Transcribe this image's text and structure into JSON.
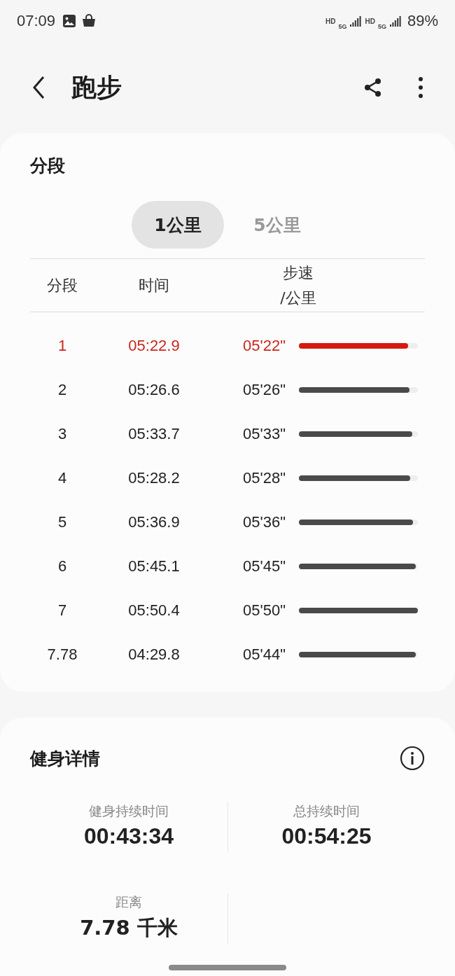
{
  "status_bar": {
    "time": "07:09",
    "battery": "89%",
    "network_labels": [
      "HD",
      "5G",
      "HD",
      "5G"
    ]
  },
  "header": {
    "title": "跑步"
  },
  "splits": {
    "title": "分段",
    "tabs": [
      {
        "label": "1公里",
        "selected": true
      },
      {
        "label": "5公里",
        "selected": false
      }
    ],
    "columns": [
      "分段",
      "时间",
      "步速\n/公里"
    ],
    "rows": [
      {
        "segment": "1",
        "time": "05:22.9",
        "pace": "05'22\"",
        "level": 0.92,
        "highlighted": true
      },
      {
        "segment": "2",
        "time": "05:26.6",
        "pace": "05'26\"",
        "level": 0.93,
        "highlighted": false
      },
      {
        "segment": "3",
        "time": "05:33.7",
        "pace": "05'33\"",
        "level": 0.95,
        "highlighted": false
      },
      {
        "segment": "4",
        "time": "05:28.2",
        "pace": "05'28\"",
        "level": 0.935,
        "highlighted": false
      },
      {
        "segment": "5",
        "time": "05:36.9",
        "pace": "05'36\"",
        "level": 0.96,
        "highlighted": false
      },
      {
        "segment": "6",
        "time": "05:45.1",
        "pace": "05'45\"",
        "level": 0.98,
        "highlighted": false
      },
      {
        "segment": "7",
        "time": "05:50.4",
        "pace": "05'50\"",
        "level": 1,
        "highlighted": false
      },
      {
        "segment": "7.78",
        "time": "04:29.8",
        "pace": "05'44\"",
        "level": 0.98,
        "highlighted": false
      }
    ]
  },
  "details": {
    "title": "健身详情",
    "stats": [
      {
        "label": "健身持续时间",
        "value": "00:43:34"
      },
      {
        "label": "总持续时间",
        "value": "00:54:25"
      },
      {
        "label": "距离",
        "value": "7.78 千米"
      }
    ]
  }
}
